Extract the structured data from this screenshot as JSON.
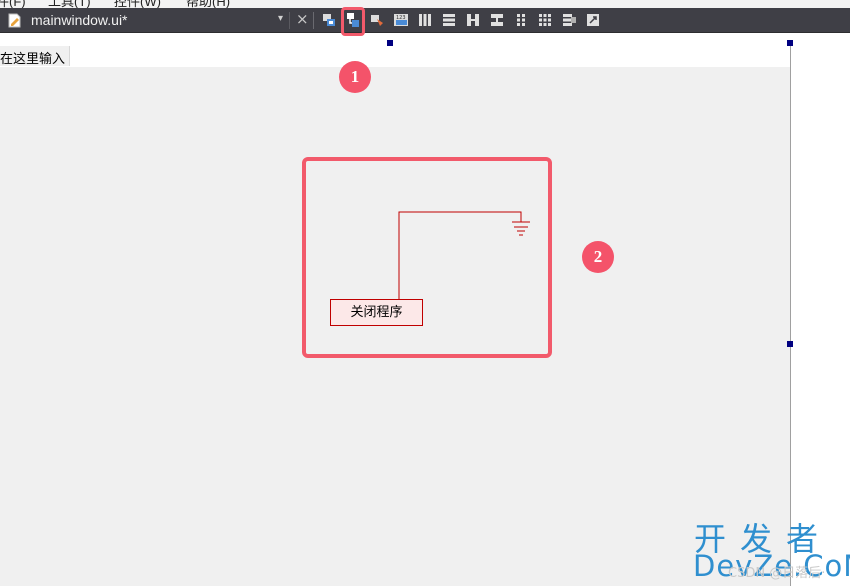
{
  "menu_strip": {
    "items": [
      "件(F)",
      "工具(T)",
      "控件(W)",
      "帮助(H)"
    ]
  },
  "document_tab": {
    "icon": "ui-file-icon",
    "title": "mainwindow.ui*",
    "dropdown_icon": "chevron-down-icon",
    "close_icon": "close-icon"
  },
  "toolbar": {
    "buttons": [
      {
        "name": "edit-widgets-icon"
      },
      {
        "name": "edit-signals-slots-icon",
        "highlighted": true
      },
      {
        "name": "edit-buddies-icon"
      },
      {
        "name": "edit-tab-order-icon"
      },
      {
        "name": "layout-horizontal-icon"
      },
      {
        "name": "layout-vertical-icon"
      },
      {
        "name": "layout-horizontal-splitter-icon"
      },
      {
        "name": "layout-vertical-splitter-icon"
      },
      {
        "name": "layout-form-icon"
      },
      {
        "name": "layout-grid-icon"
      },
      {
        "name": "break-layout-icon"
      },
      {
        "name": "adjust-size-icon"
      }
    ]
  },
  "form": {
    "menubar_placeholder": "在这里输入",
    "push_button_label": "关闭程序"
  },
  "callouts": {
    "badge_1": "1",
    "badge_2": "2",
    "color": "#f4536a"
  },
  "watermark": {
    "line1": "开发者",
    "line2": "DevZe.CoM",
    "faint": "CSDN @日落后·"
  },
  "colors": {
    "toolbar_bg": "#3f3f46",
    "form_bg": "#f0f0f0",
    "signal_wire": "#c00000",
    "highlight": "#f25a6b",
    "watermark": "#2f8fcf"
  }
}
